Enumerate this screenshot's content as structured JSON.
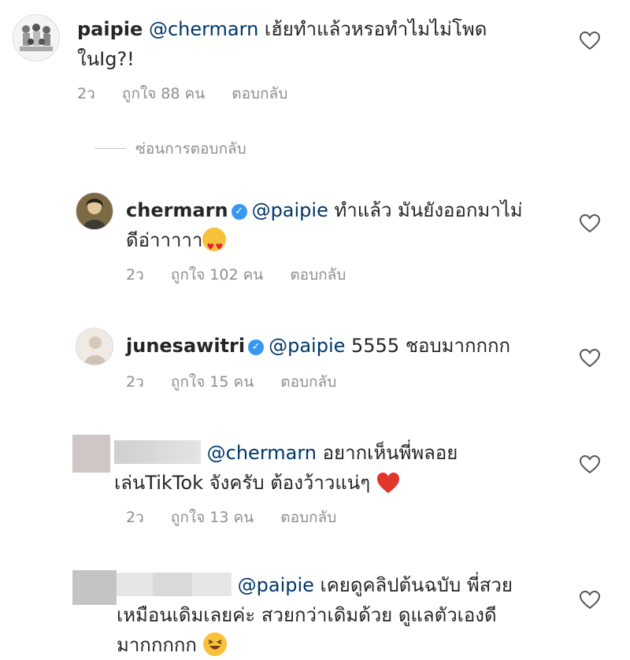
{
  "comments": [
    {
      "username": "paipie",
      "mention": "@chermarn",
      "text_line1": " เฮ้ยทำแล้วหรอทำไมไม่โพด",
      "text_line2": "ในIg?!",
      "time": "2ว",
      "likes": "ถูกใจ 88 คน",
      "reply": "ตอบกลับ"
    },
    {
      "username": "chermarn",
      "mention": "@paipie",
      "text_line1": " ทำแล้ว มันยังออกมาไม่",
      "text_line2": "ดีอ่าาาาา",
      "time": "2ว",
      "likes": "ถูกใจ 102 คน",
      "reply": "ตอบกลับ"
    },
    {
      "username": "junesawitri",
      "mention": "@paipie",
      "text_line1": " 5555 ชอบมากกกก",
      "time": "2ว",
      "likes": "ถูกใจ 15 คน",
      "reply": "ตอบกลับ"
    },
    {
      "mention": "@chermarn",
      "text_line1": " อยากเห็นพี่พลอย",
      "text_line2": "เล่นTikTok จังครับ ต้องว้าวแน่ๆ",
      "time": "2ว",
      "likes": "ถูกใจ 13 คน",
      "reply": "ตอบกลับ"
    },
    {
      "mention": "@paipie",
      "text_line1": " เคยดูคลิปต้นฉบับ พี่สวย",
      "text_line2": "เหมือนเดิมเลยค่ะ สวยกว่าเดิมด้วย ดูแลตัวเองดี",
      "text_line3": "มากกกกก"
    }
  ],
  "hide_replies": "ซ่อนการตอบกลับ",
  "icons": {
    "heart": "heart-outline-icon",
    "verified": "verified-badge-icon"
  },
  "colors": {
    "mention": "#00376b",
    "verified": "#3897f0",
    "meta": "#8e8e8e"
  }
}
